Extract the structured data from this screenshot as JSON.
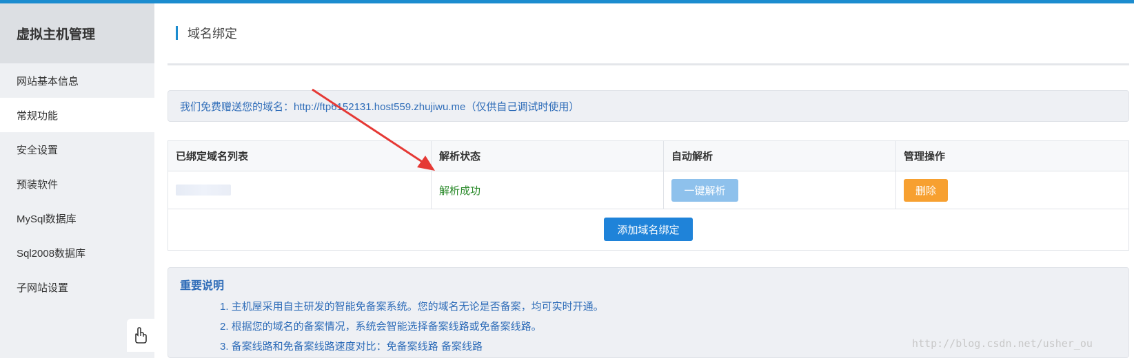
{
  "sidebar": {
    "title": "虚拟主机管理",
    "items": [
      {
        "label": "网站基本信息",
        "active": false
      },
      {
        "label": "常规功能",
        "active": true
      },
      {
        "label": "安全设置",
        "active": false
      },
      {
        "label": "预装软件",
        "active": false
      },
      {
        "label": "MySql数据库",
        "active": false
      },
      {
        "label": "Sql2008数据库",
        "active": false
      },
      {
        "label": "子网站设置",
        "active": false
      }
    ],
    "bottom_icon": "hand-pointer-icon"
  },
  "main": {
    "page_title": "域名绑定",
    "info_text": "我们免费赠送您的域名：http://ftp6152131.host559.zhujiwu.me（仅供自己调试时使用）",
    "table": {
      "headers": [
        "已绑定域名列表",
        "解析状态",
        "自动解析",
        "管理操作"
      ],
      "rows": [
        {
          "status": "解析成功",
          "resolve_button": "一键解析",
          "delete_button": "删除"
        }
      ],
      "add_button": "添加域名绑定"
    },
    "notes": {
      "title": "重要说明",
      "lines": [
        "1. 主机屋采用自主研发的智能免备案系统。您的域名无论是否备案，均可实时开通。",
        "2. 根据您的域名的备案情况，系统会智能选择备案线路或免备案线路。",
        "3. 备案线路和免备案线路速度对比：免备案线路 备案线路"
      ]
    }
  },
  "watermark": "http://blog.csdn.net/usher_ou",
  "colors": {
    "accent": "#1c8ccf",
    "link_text": "#2e6cb8",
    "success": "#2a8a2a",
    "delete": "#f7a030",
    "annotation_arrow": "#e53935"
  }
}
